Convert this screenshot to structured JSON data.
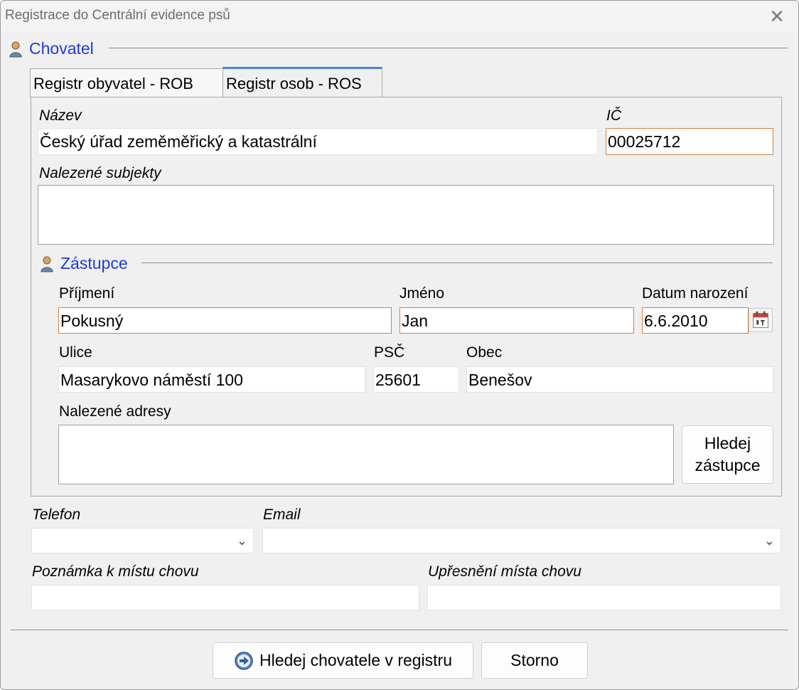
{
  "window": {
    "title": "Registrace do Centrální evidence psů",
    "close_glyph": "✕"
  },
  "chovatel": {
    "heading": "Chovatel",
    "tabs": [
      {
        "label": "Registr obyvatel - ROB",
        "active": false
      },
      {
        "label": "Registr osob - ROS",
        "active": true
      }
    ],
    "nazev_label": "Název",
    "nazev_value": "Český úřad zeměměřický a katastrální",
    "ic_label": "IČ",
    "ic_value": "00025712",
    "nalezene_subjekty_label": "Nalezené subjekty"
  },
  "zastupce": {
    "heading": "Zástupce",
    "prijmeni_label": "Příjmení",
    "prijmeni_value": "Pokusný",
    "jmeno_label": "Jméno",
    "jmeno_value": "Jan",
    "datum_label": "Datum narození",
    "datum_value": "6.6.2010",
    "ulice_label": "Ulice",
    "ulice_value": "Masarykovo náměstí 100",
    "psc_label": "PSČ",
    "psc_value": "25601",
    "obec_label": "Obec",
    "obec_value": "Benešov",
    "adresy_label": "Nalezené adresy",
    "hledej_line1": "Hledej",
    "hledej_line2": "zástupce"
  },
  "contact": {
    "telefon_label": "Telefon",
    "telefon_value": "",
    "email_label": "Email",
    "email_value": "",
    "poznamka_label": "Poznámka k místu chovu",
    "poznamka_value": "",
    "upresneni_label": "Upřesnění místa chovu",
    "upresneni_value": ""
  },
  "footer": {
    "search_button": "Hledej chovatele v registru",
    "cancel_button": "Storno"
  },
  "icons": [
    "person-icon",
    "calendar-icon",
    "chevron-down-icon",
    "arrow-right-circle-icon",
    "close-icon"
  ],
  "colors": {
    "section_heading": "#1f3bd8",
    "required_border": "#d6803a",
    "tab_active_accent": "#4a86d4"
  }
}
